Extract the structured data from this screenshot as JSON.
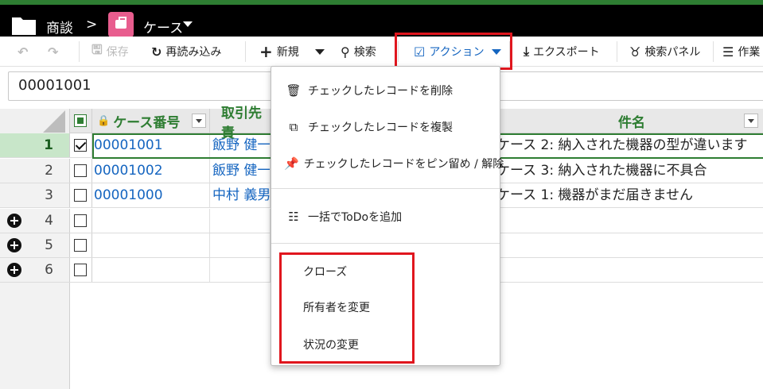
{
  "header": {
    "crumb1": "商談",
    "separator": ">",
    "crumb2": "ケース"
  },
  "toolbar": {
    "save": "保存",
    "reload": "再読み込み",
    "new": "新規",
    "search": "検索",
    "action": "アクション",
    "export": "エクスポート",
    "search_panel": "検索パネル",
    "work": "作業"
  },
  "search": {
    "value": "00001001"
  },
  "grid": {
    "columns": {
      "case_no": "ケース番号",
      "account": "取引先責",
      "subject": "件名"
    },
    "rows": [
      {
        "num": "1",
        "checked": true,
        "case_no": "00001001",
        "account": "飯野 健一",
        "subject": "ケース 2: 納入された機器の型が違います"
      },
      {
        "num": "2",
        "checked": false,
        "case_no": "00001002",
        "account": "飯野 健一",
        "subject": "ケース 3: 納入された機器に不具合"
      },
      {
        "num": "3",
        "checked": false,
        "case_no": "00001000",
        "account": "中村 義男",
        "subject": "ケース 1: 機器がまだ届きません"
      },
      {
        "num": "4",
        "checked": false,
        "case_no": "",
        "account": "",
        "subject": ""
      },
      {
        "num": "5",
        "checked": false,
        "case_no": "",
        "account": "",
        "subject": ""
      },
      {
        "num": "6",
        "checked": false,
        "case_no": "",
        "account": "",
        "subject": ""
      }
    ]
  },
  "menu": {
    "delete": "チェックしたレコードを削除",
    "duplicate": "チェックしたレコードを複製",
    "pin": "チェックしたレコードをピン留め / 解除",
    "todo": "一括でToDoを追加",
    "close": "クローズ",
    "change_owner": "所有者を変更",
    "change_status": "状況の変更"
  },
  "colors": {
    "accent_green": "#2e7d32",
    "link_blue": "#1565c0",
    "highlight_red": "#e0161e",
    "case_pink": "#e85d8e"
  }
}
